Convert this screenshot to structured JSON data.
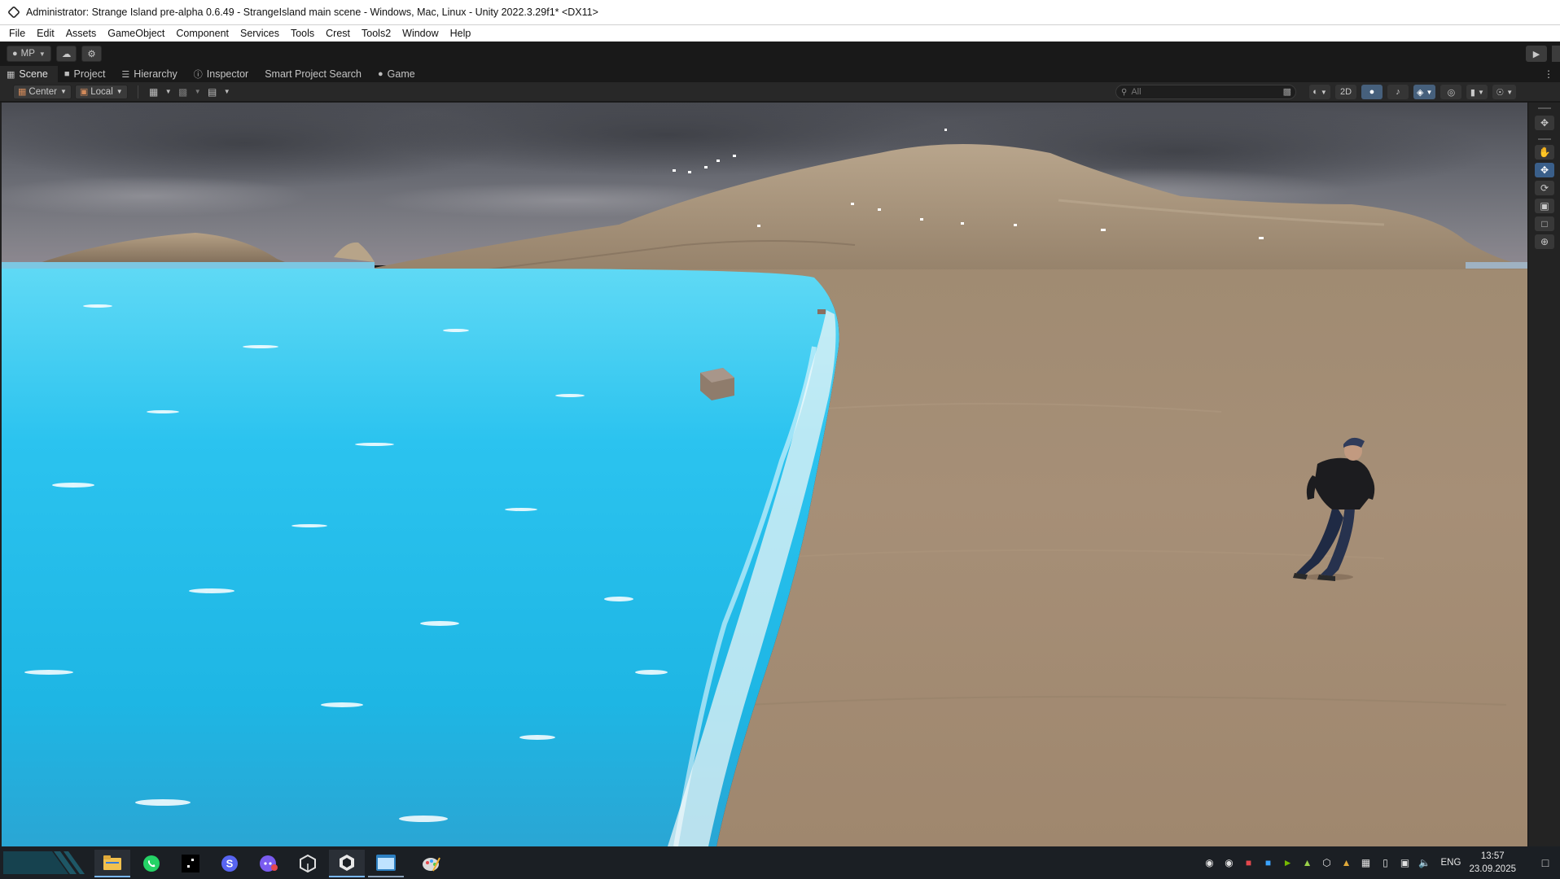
{
  "window": {
    "title": "Administrator: Strange Island pre-alpha 0.6.49 - StrangeIsland main scene - Windows, Mac, Linux - Unity 2022.3.29f1* <DX11>"
  },
  "menu": [
    "File",
    "Edit",
    "Assets",
    "GameObject",
    "Component",
    "Services",
    "Tools",
    "Crest",
    "Tools2",
    "Window",
    "Help"
  ],
  "toolbar": {
    "account_label": "MP"
  },
  "tabs": [
    {
      "label": "Scene",
      "icon": "grid-icon",
      "active": true
    },
    {
      "label": "Project",
      "icon": "folder-icon",
      "active": false
    },
    {
      "label": "Hierarchy",
      "icon": "list-icon",
      "active": false
    },
    {
      "label": "Inspector",
      "icon": "info-icon",
      "active": false
    },
    {
      "label": "Smart Project Search",
      "icon": "",
      "active": false
    },
    {
      "label": "Game",
      "icon": "gamepad-icon",
      "active": false
    }
  ],
  "scene_toolbar": {
    "pivot_mode": "Center",
    "pivot_rotation": "Local",
    "search_placeholder": "All",
    "mode_2d": "2D"
  },
  "taskbar": {
    "apps": [
      "file-explorer",
      "whatsapp",
      "app-black",
      "skype",
      "discord",
      "unity-hub",
      "unity-editor",
      "window-app",
      "paint-app"
    ],
    "language": "ENG",
    "time": "13:57",
    "date": "23.09.2025"
  },
  "colors": {
    "accent": "#3a5f8a",
    "water": "#2fc4ef",
    "sand": "#a48c73",
    "sky": "#5d6069"
  }
}
